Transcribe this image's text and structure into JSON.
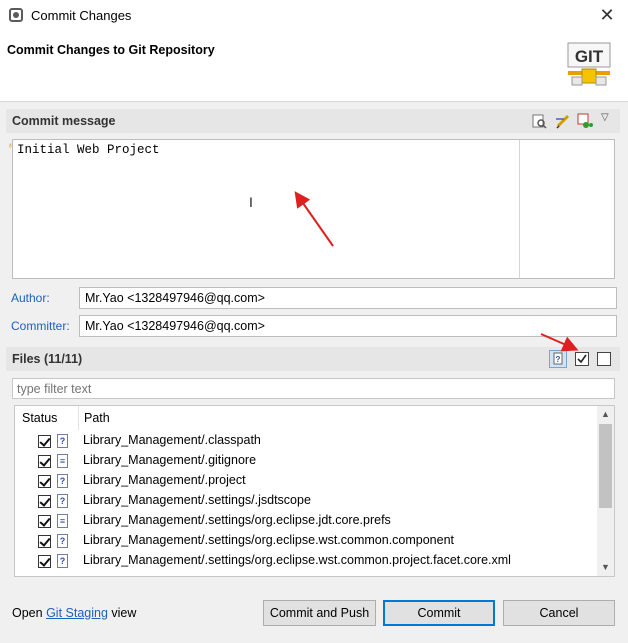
{
  "window": {
    "title": "Commit Changes"
  },
  "header": {
    "title": "Commit Changes to Git Repository",
    "logo_text": "GIT"
  },
  "commit_section": {
    "title": "Commit message",
    "message": "Initial Web Project"
  },
  "author": {
    "label": "Author:",
    "value": "Mr.Yao <1328497946@qq.com>"
  },
  "committer": {
    "label": "Committer:",
    "value": "Mr.Yao <1328497946@qq.com>"
  },
  "files_section": {
    "title": "Files (11/11)",
    "filter_placeholder": "type filter text"
  },
  "table": {
    "columns": [
      "Status",
      "Path"
    ],
    "rows": [
      {
        "path": "Library_Management/.classpath",
        "icon": "unknown-file-icon"
      },
      {
        "path": "Library_Management/.gitignore",
        "icon": "text-file-icon"
      },
      {
        "path": "Library_Management/.project",
        "icon": "unknown-file-icon"
      },
      {
        "path": "Library_Management/.settings/.jsdtscope",
        "icon": "unknown-file-icon"
      },
      {
        "path": "Library_Management/.settings/org.eclipse.jdt.core.prefs",
        "icon": "text-file-icon"
      },
      {
        "path": "Library_Management/.settings/org.eclipse.wst.common.component",
        "icon": "unknown-file-icon"
      },
      {
        "path": "Library_Management/.settings/org.eclipse.wst.common.project.facet.core.xml",
        "icon": "unknown-file-icon"
      }
    ]
  },
  "footer": {
    "open_text": "Open",
    "link_text": "Git Staging",
    "view_text": "view"
  },
  "buttons": {
    "commit_and_push": "Commit and Push",
    "commit": "Commit",
    "cancel": "Cancel"
  },
  "colors": {
    "link": "#1e5fbf",
    "annotation_arrow": "#e02020",
    "primary_border": "#0078d7"
  }
}
